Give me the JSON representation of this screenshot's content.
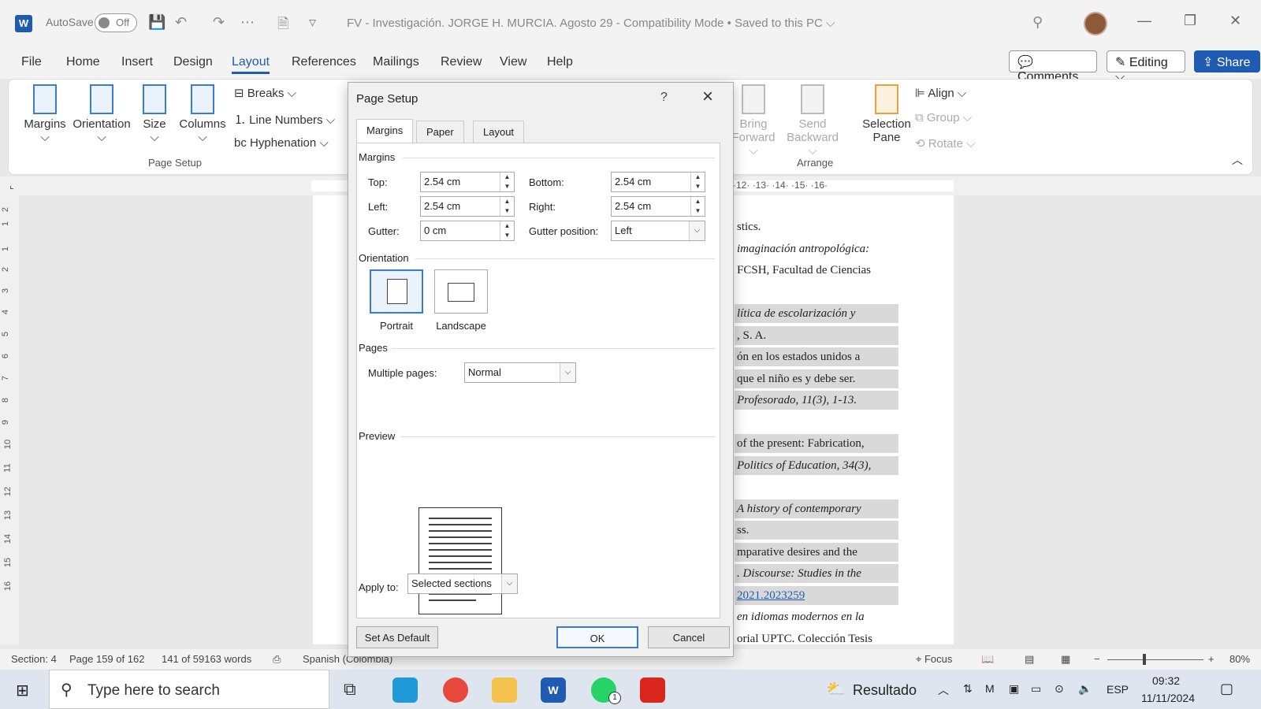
{
  "titlebar": {
    "autosave_label": "AutoSave",
    "autosave_state": "Off",
    "document_title": "FV - Investigación. JORGE H. MURCIA. Agosto 29  -  Compatibility Mode • Saved to this PC ⌵"
  },
  "menu": {
    "tabs": [
      "File",
      "Home",
      "Insert",
      "Design",
      "Layout",
      "References",
      "Mailings",
      "Review",
      "View",
      "Help"
    ],
    "active_tab": "Layout",
    "comments_label": "Comments",
    "editing_label": "Editing",
    "share_label": "Share"
  },
  "ribbon": {
    "margins": "Margins",
    "orientation": "Orientation",
    "size": "Size",
    "columns": "Columns",
    "breaks": "Breaks",
    "line_numbers": "Line Numbers",
    "hyphenation": "Hyphenation",
    "page_setup_group": "Page Setup",
    "bring_forward_1": "Bring",
    "bring_forward_2": "Forward",
    "send_backward_1": "Send",
    "send_backward_2": "Backward",
    "selection_pane_1": "Selection",
    "selection_pane_2": "Pane",
    "align": "Align",
    "group": "Group",
    "rotate": "Rotate",
    "arrange_group": "Arrange"
  },
  "ruler": {
    "top_numbers": "·12· ·13· ·14· ·15· ·16·",
    "left_numbers": [
      "2",
      "1",
      "1",
      "2",
      "3",
      "4",
      "5",
      "6",
      "7",
      "8",
      "9",
      "10",
      "11",
      "12",
      "13",
      "14",
      "15",
      "16"
    ]
  },
  "document": {
    "lines": [
      {
        "text": "stics.",
        "highlight": false,
        "italic": false
      },
      {
        "text": "imaginación antropológica:",
        "highlight": false,
        "italic": true
      },
      {
        "text": "FCSH, Facultad de Ciencias",
        "highlight": false,
        "italic": false
      },
      {
        "text": "",
        "highlight": false,
        "italic": false
      },
      {
        "text": "lítica de escolarización y",
        "highlight": true,
        "italic": true
      },
      {
        "text": ", S. A.",
        "highlight": true,
        "italic": false
      },
      {
        "text": "ón en los estados unidos a",
        "highlight": true,
        "italic": false
      },
      {
        "text": "que el niño es y debe ser.",
        "highlight": true,
        "italic": false
      },
      {
        "text": "Profesorado, 11(3), 1-13.",
        "highlight": true,
        "italic": true
      },
      {
        "text": "",
        "highlight": false,
        "italic": false
      },
      {
        "text": "of the present: Fabrication,",
        "highlight": true,
        "italic": false
      },
      {
        "text": "Politics of Education, 34(3),",
        "highlight": true,
        "italic": true
      },
      {
        "text": "",
        "highlight": false,
        "italic": false
      },
      {
        "text": "A history of contemporary",
        "highlight": true,
        "italic": true
      },
      {
        "text": "ss.",
        "highlight": true,
        "italic": false
      },
      {
        "text": "mparative desires and the",
        "highlight": true,
        "italic": false
      },
      {
        "text": ". Discourse: Studies in the",
        "highlight": true,
        "italic": true
      },
      {
        "text": "2021.2023259",
        "highlight": true,
        "italic": false,
        "link": true
      },
      {
        "text": "en idiomas modernos en la",
        "highlight": false,
        "italic": true
      },
      {
        "text": "orial UPTC. Colección Tesis",
        "highlight": false,
        "italic": false
      }
    ]
  },
  "dialog": {
    "title": "Page Setup",
    "help": "?",
    "tabs": [
      "Margins",
      "Paper",
      "Layout"
    ],
    "active_tab": "Margins",
    "margins_section": "Margins",
    "top_label": "Top:",
    "top_value": "2.54 cm",
    "bottom_label": "Bottom:",
    "bottom_value": "2.54 cm",
    "left_label": "Left:",
    "left_value": "2.54 cm",
    "right_label": "Right:",
    "right_value": "2.54 cm",
    "gutter_label": "Gutter:",
    "gutter_value": "0 cm",
    "gutter_position_label": "Gutter position:",
    "gutter_position_value": "Left",
    "orientation_section": "Orientation",
    "portrait_label": "Portrait",
    "landscape_label": "Landscape",
    "selected_orientation": "Portrait",
    "pages_section": "Pages",
    "multiple_pages_label": "Multiple pages:",
    "multiple_pages_value": "Normal",
    "preview_section": "Preview",
    "apply_to_label": "Apply to:",
    "apply_to_value": "Selected sections",
    "set_default_label": "Set As Default",
    "ok_label": "OK",
    "cancel_label": "Cancel"
  },
  "statusbar": {
    "section": "Section: 4",
    "page": "Page 159 of 162",
    "words": "141 of 59163 words",
    "language": "Spanish (Colombia)",
    "focus": "Focus",
    "zoom": "80%"
  },
  "taskbar": {
    "search_placeholder": "Type here to search",
    "weather": "Resultado",
    "language": "ESP",
    "time": "09:32",
    "date": "11/11/2024",
    "whatsapp_badge": "1"
  },
  "colors": {
    "accent": "#1f5bb3",
    "highlight": "#d9d9d9",
    "dialog_bg": "#f0f0f0"
  }
}
